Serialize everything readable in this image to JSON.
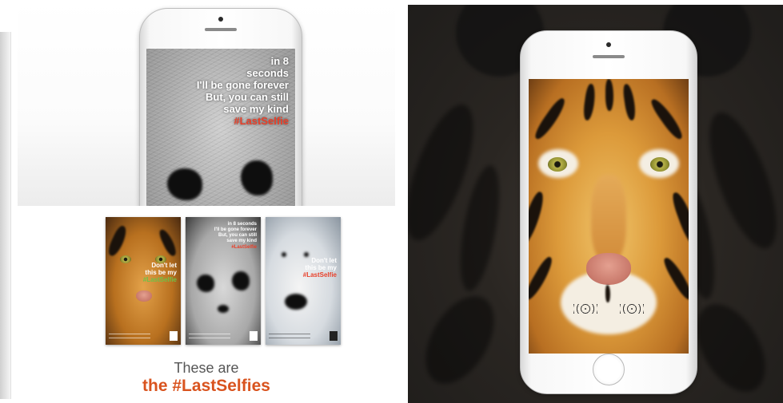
{
  "panda_phone": {
    "lines": [
      "in 8",
      "seconds",
      "I'll be gone forever",
      "But, you can still",
      "save my kind"
    ],
    "hashtag": "#LastSelfie"
  },
  "posters": [
    {
      "animal": "tiger",
      "lines": [
        "Don't let",
        "this be my"
      ],
      "hashtag": "#LastSelfie",
      "hashtag_color": "#6cc24a"
    },
    {
      "animal": "panda",
      "lines": [
        "in 8 seconds",
        "I'll be gone forever",
        "But, you can still",
        "save my kind"
      ],
      "hashtag": "#LastSelfie",
      "hashtag_color": "#e8402a"
    },
    {
      "animal": "polar-bear",
      "lines": [
        "Don't let",
        "this be my"
      ],
      "hashtag": "#LastSelfie",
      "hashtag_color": "#e8402a"
    }
  ],
  "tagline": {
    "line1": "These are",
    "line2": "the #LastSelfies"
  },
  "colors": {
    "accent_orange": "#d9531e",
    "hashtag_red": "#e8402a",
    "hashtag_green": "#6cc24a"
  }
}
